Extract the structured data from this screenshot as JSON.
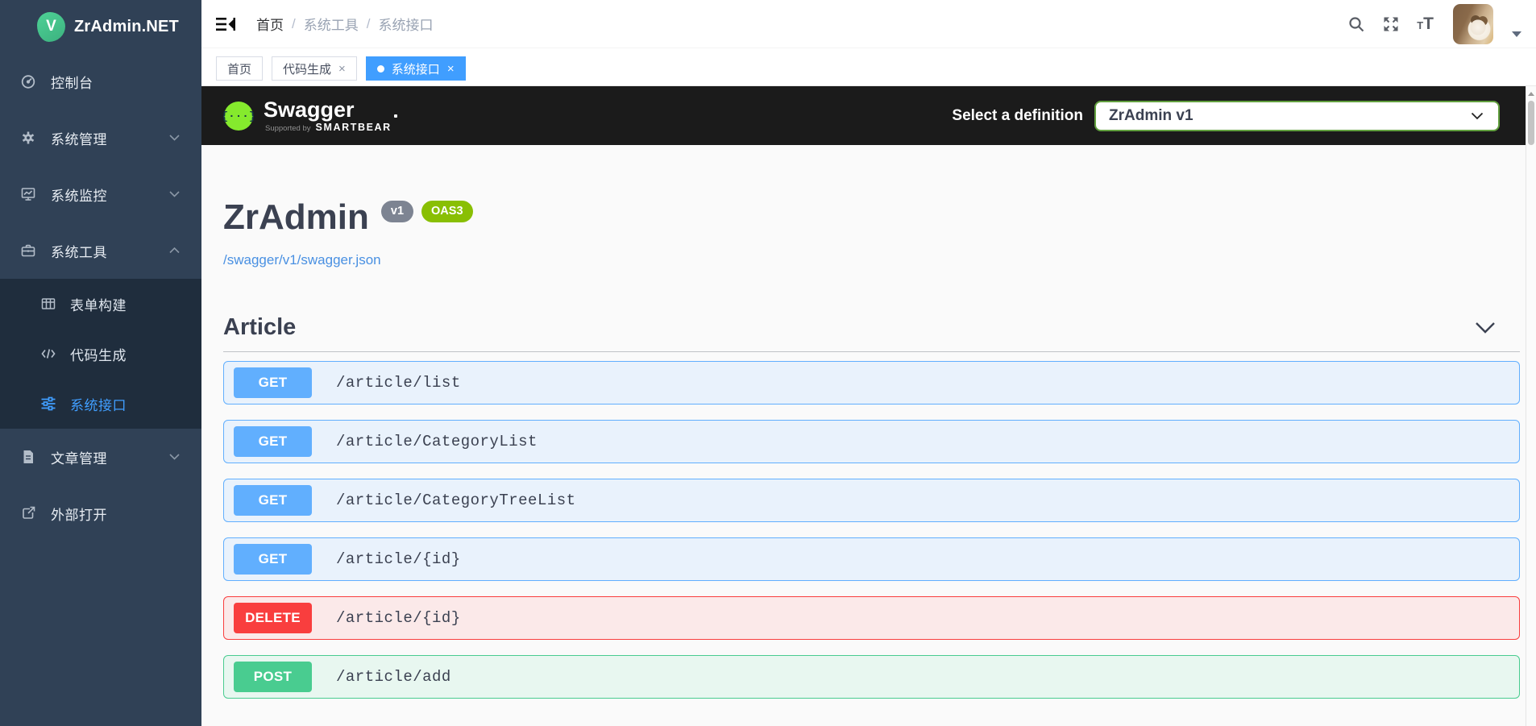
{
  "app": {
    "title": "ZrAdmin.NET",
    "logo_letter": "V"
  },
  "sidebar": {
    "items": [
      {
        "label": "控制台"
      },
      {
        "label": "系统管理"
      },
      {
        "label": "系统监控"
      },
      {
        "label": "系统工具"
      },
      {
        "label": "表单构建"
      },
      {
        "label": "代码生成"
      },
      {
        "label": "系统接口"
      },
      {
        "label": "文章管理"
      },
      {
        "label": "外部打开"
      }
    ]
  },
  "navbar": {
    "breadcrumb": {
      "home": "首页",
      "section": "系统工具",
      "page": "系统接口"
    },
    "separator": "/"
  },
  "tabs": {
    "items": [
      {
        "label": "首页"
      },
      {
        "label": "代码生成"
      },
      {
        "label": "系统接口"
      }
    ]
  },
  "icons": {
    "close": "×",
    "font_small": "T",
    "font_large": "T"
  },
  "swagger": {
    "brand": "Swagger",
    "supported_by": "Supported by",
    "smartbear": "SMARTBEAR",
    "select_label": "Select a definition",
    "selected_definition": "ZrAdmin v1"
  },
  "api": {
    "title": "ZrAdmin",
    "version_badge": "v1",
    "oas_badge": "OAS3",
    "spec_link": "/swagger/v1/swagger.json"
  },
  "section": {
    "title": "Article"
  },
  "endpoints": [
    {
      "method": "GET",
      "path": "/article/list"
    },
    {
      "method": "GET",
      "path": "/article/CategoryList"
    },
    {
      "method": "GET",
      "path": "/article/CategoryTreeList"
    },
    {
      "method": "GET",
      "path": "/article/{id}"
    },
    {
      "method": "DELETE",
      "path": "/article/{id}"
    },
    {
      "method": "POST",
      "path": "/article/add"
    }
  ],
  "colors": {
    "get": "#61affe",
    "post": "#49cc90",
    "delete": "#f93e3e",
    "active_accent": "#409eff",
    "oas3_badge": "#89bf04",
    "version_badge": "#7d8492",
    "link": "#4990e2",
    "sidebar_bg": "#304156",
    "submenu_bg": "#1f2d3d",
    "swagger_bar": "#1b1b1b",
    "logo_green": "#42b983",
    "swagger_green": "#85ea2d"
  }
}
